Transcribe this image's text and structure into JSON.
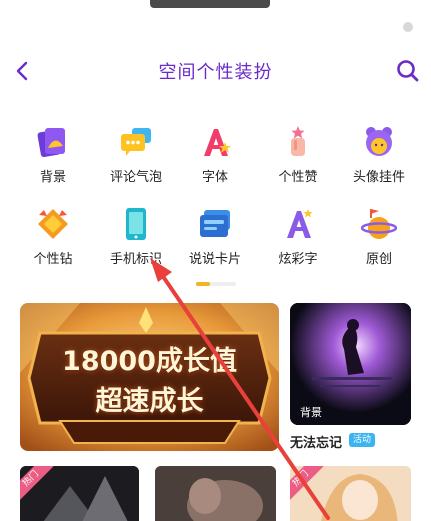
{
  "header": {
    "title": "空间个性装扮"
  },
  "grid": {
    "items": [
      {
        "label": "背景",
        "icon": "background-icon"
      },
      {
        "label": "评论气泡",
        "icon": "comment-bubble-icon"
      },
      {
        "label": "字体",
        "icon": "font-icon"
      },
      {
        "label": "个性赞",
        "icon": "like-icon"
      },
      {
        "label": "头像挂件",
        "icon": "avatar-pendant-icon"
      },
      {
        "label": "个性钻",
        "icon": "diamond-icon"
      },
      {
        "label": "手机标识",
        "icon": "phone-icon"
      },
      {
        "label": "说说卡片",
        "icon": "card-icon"
      },
      {
        "label": "炫彩字",
        "icon": "color-text-icon"
      },
      {
        "label": "原创",
        "icon": "original-icon"
      }
    ]
  },
  "banner": {
    "line1": "18000成长值",
    "line2": "超速成长"
  },
  "feature_card": {
    "tag": "背景",
    "title": "无法忘记",
    "badge": "活动"
  },
  "bottom_cards": [
    {
      "ribbon": "热门"
    },
    {
      "ribbon": ""
    },
    {
      "ribbon": "热门"
    }
  ],
  "colors": {
    "accent": "#6a2cc9",
    "pager_active": "#f5b41f",
    "annotation_arrow": "#e8403a",
    "badge": "#3cb4f0",
    "ribbon": "#ec5d86"
  }
}
